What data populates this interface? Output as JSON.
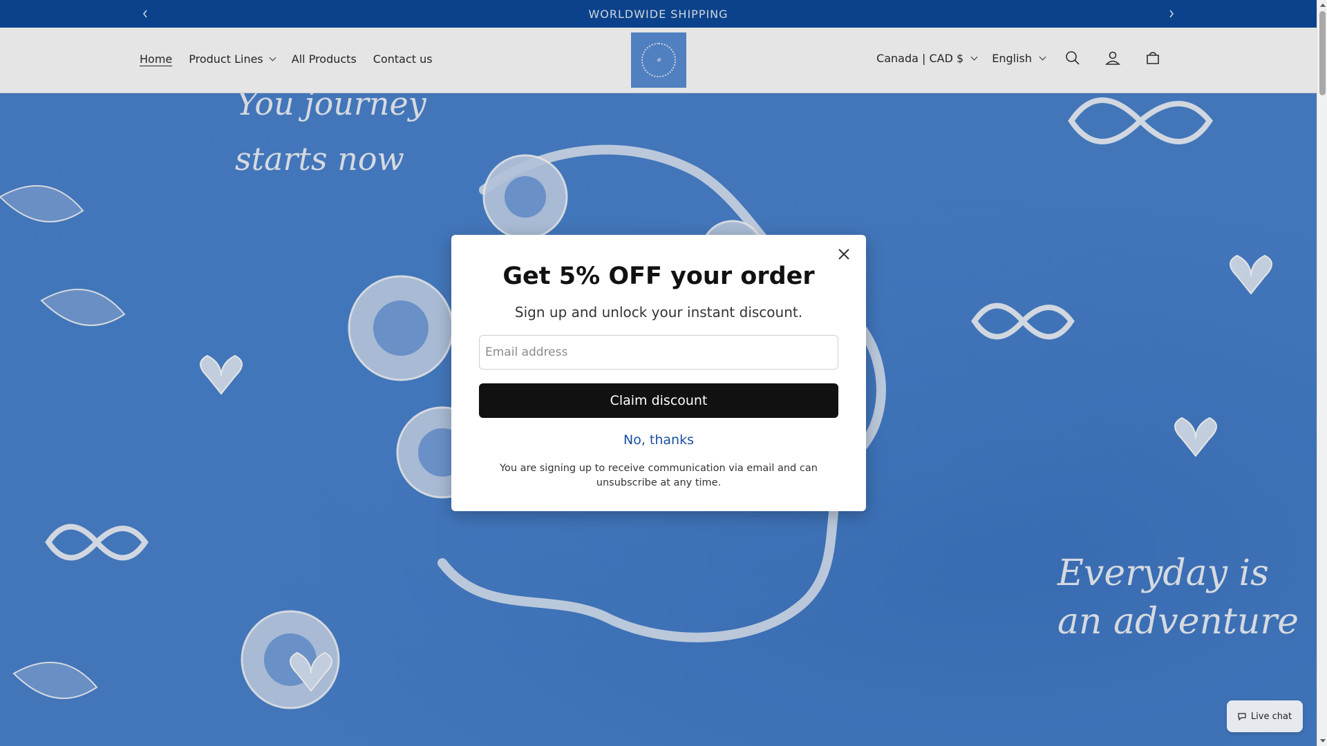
{
  "announcement": {
    "text": "WORLDWIDE SHIPPING",
    "prev_icon": "chevron-left-icon",
    "next_icon": "chevron-right-icon"
  },
  "header": {
    "nav": [
      {
        "label": "Home",
        "active": true
      },
      {
        "label": "Product Lines",
        "dropdown": true
      },
      {
        "label": "All Products"
      },
      {
        "label": "Contact us"
      }
    ],
    "country_selector": "Canada | CAD $",
    "language_selector": "English",
    "icons": [
      "search-icon",
      "account-icon",
      "cart-icon"
    ]
  },
  "hero": {
    "script_top": [
      "You journey",
      "starts now"
    ],
    "script_bottom": [
      "Everyday is",
      "an adventure"
    ]
  },
  "modal": {
    "title": "Get 5% OFF your order",
    "subtitle": "Sign up and unlock your instant discount.",
    "email_placeholder": "Email address",
    "email_value": "",
    "claim_label": "Claim discount",
    "decline_label": "No, thanks",
    "legal": "You are signing up to receive communication via email and can unsubscribe at any time."
  },
  "livechat": {
    "label": "Live chat"
  },
  "colors": {
    "announcement_bg": "#0d4a9b",
    "hero_bg": "#4b83cf",
    "button_bg": "#111111",
    "link": "#1a4fa0"
  }
}
